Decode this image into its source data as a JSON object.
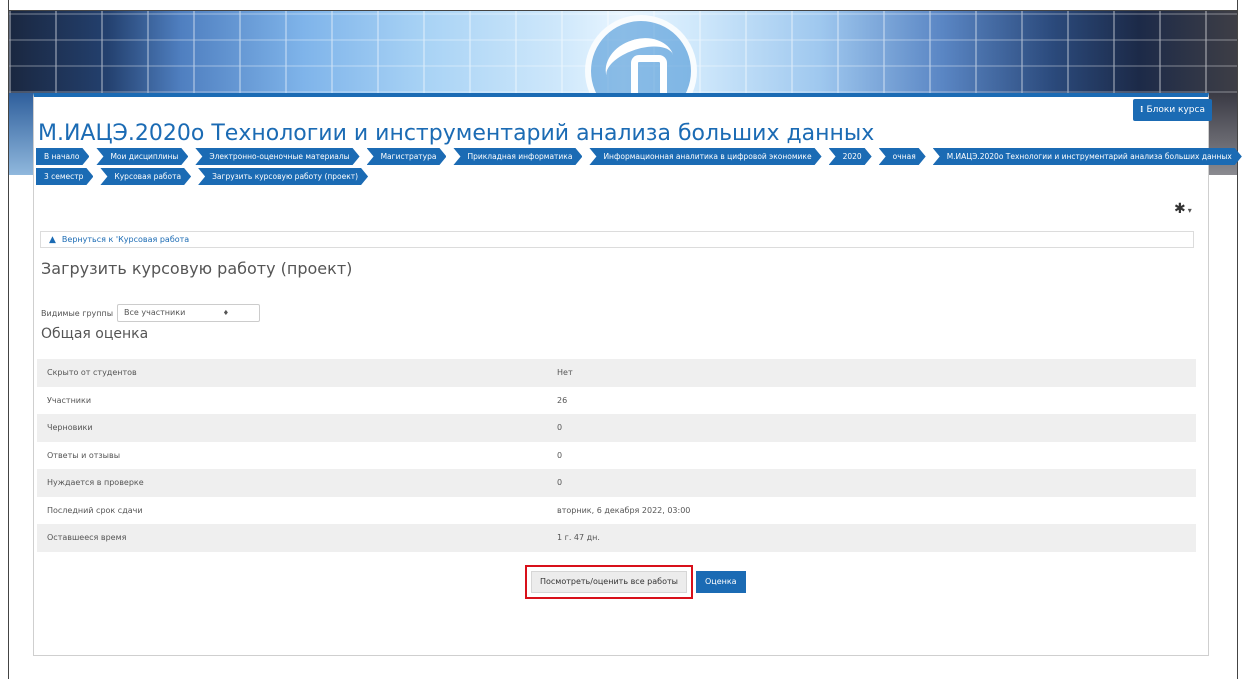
{
  "header": {
    "blocks_label": "Блоки курса",
    "course_title": "М.ИАЦЭ.2020о Технологии и инструментарий анализа больших данных"
  },
  "breadcrumb": {
    "row1": [
      "В начало",
      "Мои дисциплины",
      "Электронно-оценочные материалы",
      "Магистратура",
      "Прикладная информатика",
      "Информационная аналитика в цифровой экономике",
      "2020",
      "очная",
      "М.ИАЦЭ.2020о Технологии и инструментарий анализа больших данных"
    ],
    "row2": [
      "3 семестр",
      "Курсовая работа",
      "Загрузить курсовую работу (проект)"
    ]
  },
  "back_link": "Вернуться к 'Курсовая работа",
  "page_heading": "Загрузить курсовую работу (проект)",
  "groups": {
    "label": "Видимые группы",
    "selected": "Все участники"
  },
  "section_heading": "Общая оценка",
  "summary": [
    {
      "key": "Скрыто от студентов",
      "value": "Нет"
    },
    {
      "key": "Участники",
      "value": "26"
    },
    {
      "key": "Черновики",
      "value": "0"
    },
    {
      "key": "Ответы и отзывы",
      "value": "0"
    },
    {
      "key": "Нуждается в проверке",
      "value": "0"
    },
    {
      "key": "Последний срок сдачи",
      "value": "вторник, 6 декабря 2022, 03:00"
    },
    {
      "key": "Оставшееся время",
      "value": "1 г. 47 дн."
    }
  ],
  "actions": {
    "view_all": "Посмотреть/оценить все работы",
    "grade": "Оценка"
  },
  "colors": {
    "brand": "#1b6bb4",
    "highlight": "#d8101a"
  }
}
